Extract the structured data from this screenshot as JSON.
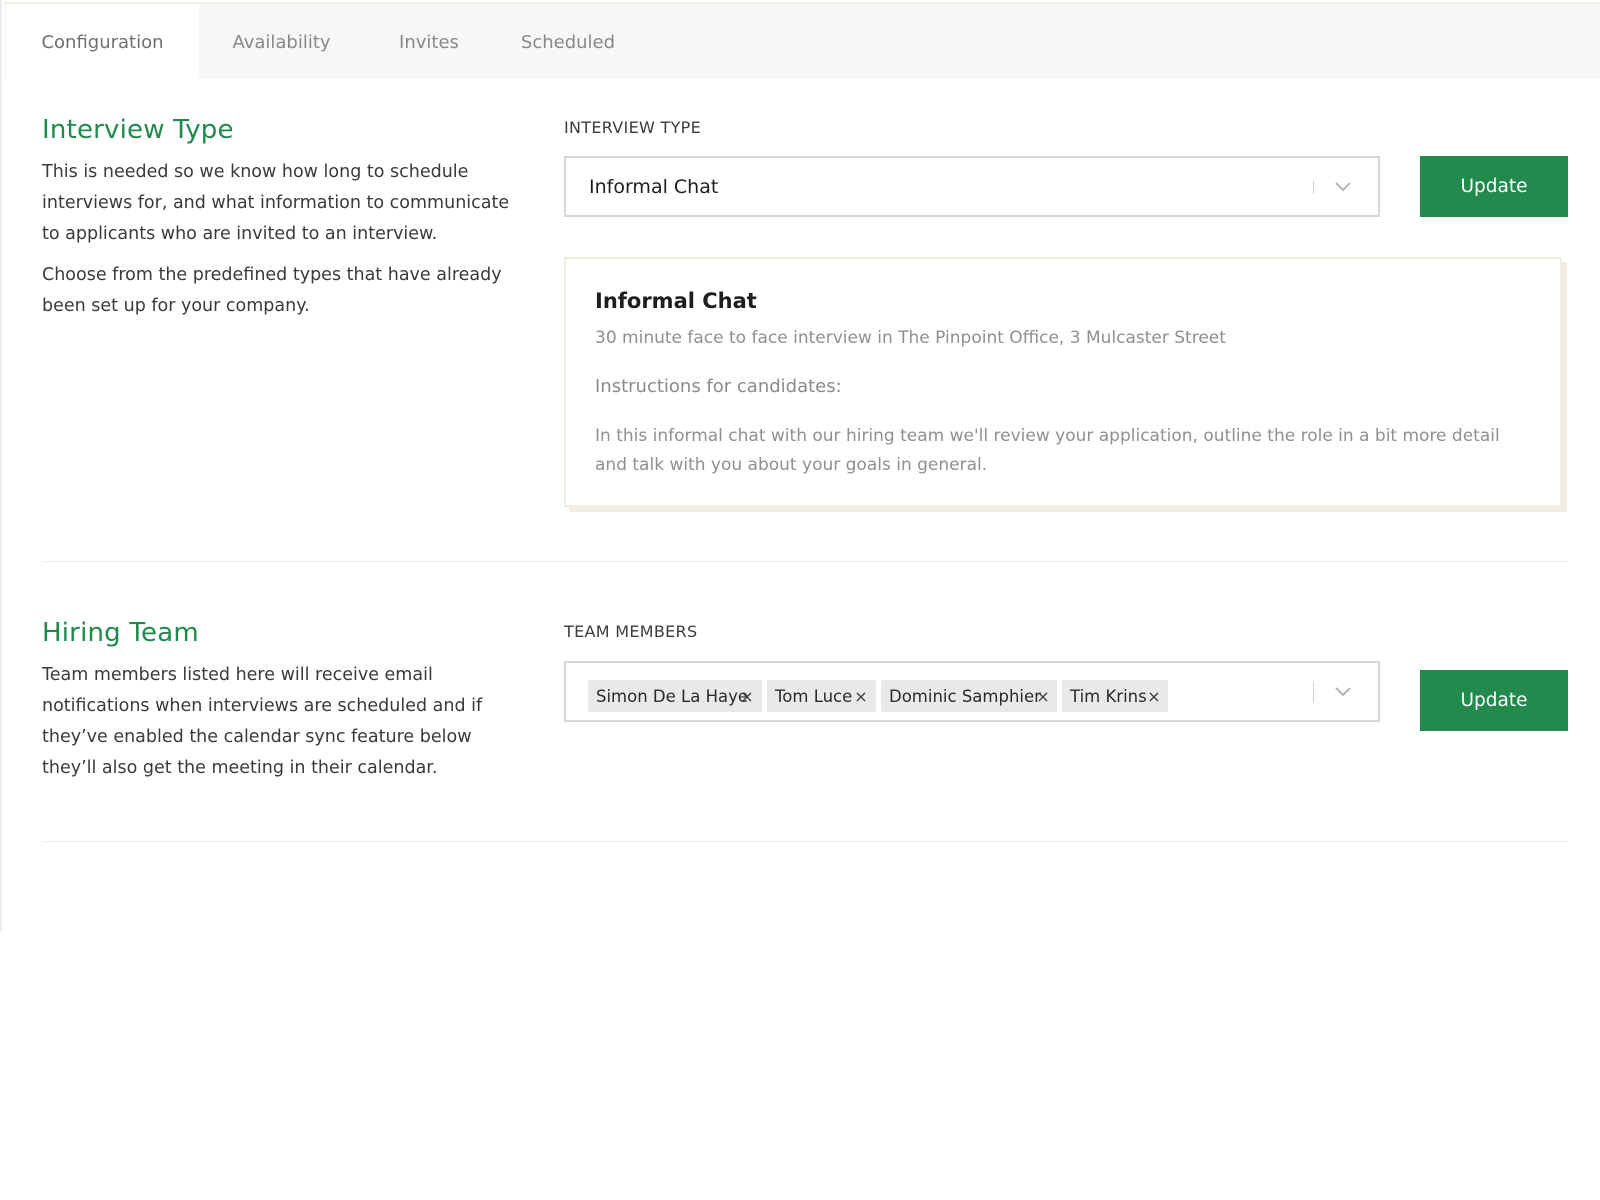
{
  "tabs": [
    {
      "label": "Configuration",
      "active": true
    },
    {
      "label": "Availability",
      "active": false
    },
    {
      "label": "Invites",
      "active": false
    },
    {
      "label": "Scheduled",
      "active": false
    }
  ],
  "interview_type": {
    "title": "Interview Type",
    "description_1": "This is needed so we know how long to schedule interviews for, and what information to communicate to applicants who are invited to an interview.",
    "description_2": "Choose from the predefined types that have already been set up for your company.",
    "field_label": "INTERVIEW TYPE",
    "selected_value": "Informal Chat",
    "update_label": "Update",
    "card": {
      "title": "Informal Chat",
      "subtitle": "30 minute face to face interview in The Pinpoint Office, 3 Mulcaster Street",
      "instructions_label": "Instructions for candidates:",
      "instructions": "In this informal chat with our hiring team we'll review your application, outline the role in a bit more detail and talk with you about your goals in general."
    }
  },
  "hiring_team": {
    "title": "Hiring Team",
    "description": "Team members listed here will receive email notifications when interviews are scheduled and if they’ve enabled the calendar sync feature below they’ll also get the meeting in their calendar.",
    "field_label": "TEAM MEMBERS",
    "members": [
      "Simon De La Haye",
      "Tom Luce",
      "Dominic Samphier",
      "Tim Krins"
    ],
    "remove_symbol": "×",
    "update_label": "Update"
  },
  "colors": {
    "accent": "#218a4c",
    "heading_green": "#208a4c"
  },
  "icons": {
    "select_chevron": "chevron-down-icon",
    "tag_remove": "close-icon"
  }
}
